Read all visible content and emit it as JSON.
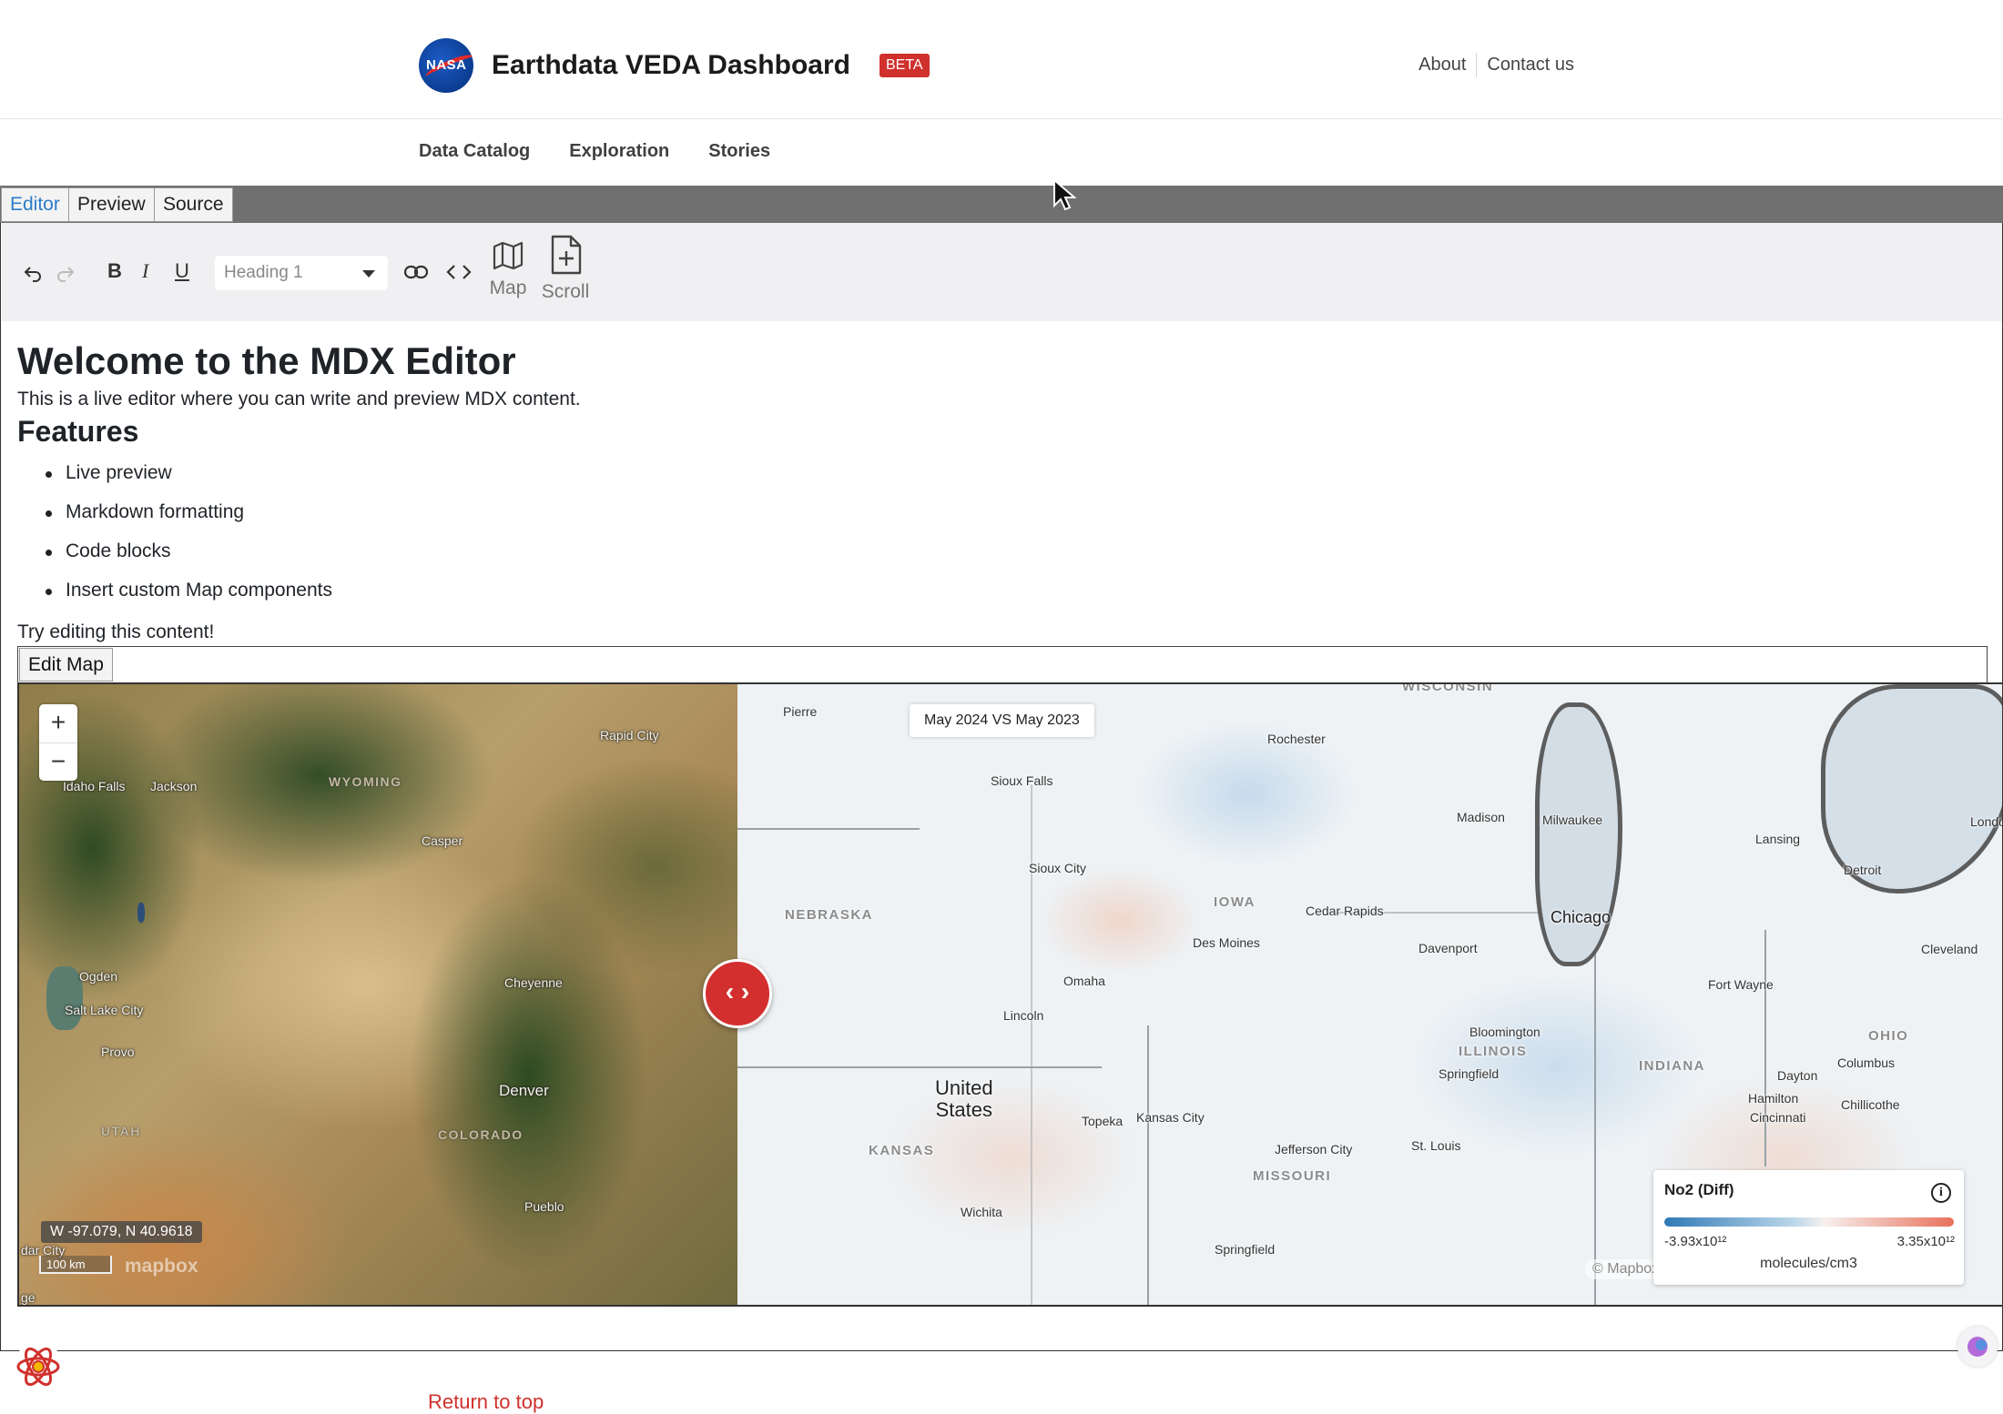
{
  "header": {
    "logo_icon": "nasa-logo",
    "logo_text": "NASA",
    "title": "Earthdata VEDA Dashboard",
    "badge": "BETA",
    "links": [
      "About",
      "Contact us"
    ]
  },
  "nav": [
    "Data Catalog",
    "Exploration",
    "Stories"
  ],
  "editor_tabs": {
    "editor": "Editor",
    "preview": "Preview",
    "source": "Source",
    "active": "Editor"
  },
  "toolbar": {
    "undo_icon": "undo-icon",
    "redo_icon": "redo-icon",
    "bold": "B",
    "italic": "I",
    "underline": "U",
    "block_type": "Heading 1",
    "link_icon": "link-icon",
    "code_icon": "code-icon",
    "map_label": "Map",
    "scroll_label": "Scroll"
  },
  "content": {
    "h1": "Welcome to the MDX Editor",
    "intro": "This is a live editor where you can write and preview MDX content.",
    "h2": "Features",
    "features": [
      "Live preview",
      "Markdown formatting",
      "Code blocks",
      "Insert custom Map components"
    ],
    "closing": "Try editing this content!"
  },
  "map": {
    "edit_button": "Edit Map",
    "zoom_in": "+",
    "zoom_out": "−",
    "coordinates": "W -97.079, N 40.9618",
    "scale": "100 km",
    "mapbox_logo": "mapbox",
    "compare_label": "May 2024 VS May 2023",
    "slider_handle": "‹ ›",
    "attribution": "© Mapbox ©",
    "left_places": {
      "rapid_city": "Rapid City",
      "idaho_falls": "Idaho Falls",
      "jackson": "Jackson",
      "wyoming": "WYOMING",
      "casper": "Casper",
      "ogden": "Ogden",
      "salt_lake_city": "Salt Lake City",
      "cheyenne": "Cheyenne",
      "provo": "Provo",
      "denver": "Denver",
      "utah": "UTAH",
      "colorado": "COLORADO",
      "pueblo": "Pueblo",
      "dar_city": "dar City",
      "ge": "ge"
    },
    "right_places": {
      "pierre": "Pierre",
      "wisconsin": "WISCONSIN",
      "rochester": "Rochester",
      "sioux_falls": "Sioux Falls",
      "madison": "Madison",
      "milwaukee": "Milwaukee",
      "london": "London",
      "lansing": "Lansing",
      "sioux_city": "Sioux City",
      "detroit": "Detroit",
      "nebraska": "NEBRASKA",
      "iowa": "IOWA",
      "cedar_rapids": "Cedar Rapids",
      "chicago": "Chicago",
      "des_moines": "Des Moines",
      "davenport": "Davenport",
      "cleveland": "Cleveland",
      "omaha": "Omaha",
      "fort_wayne": "Fort Wayne",
      "lincoln": "Lincoln",
      "bloomington": "Bloomington",
      "ohio": "OHIO",
      "illinois": "ILLINOIS",
      "indiana": "INDIANA",
      "columbus": "Columbus",
      "springfield_il": "Springfield",
      "dayton": "Dayton",
      "united_states": "United\nStates",
      "hamilton": "Hamilton",
      "chillicothe": "Chillicothe",
      "cincinnati": "Cincinnati",
      "topeka": "Topeka",
      "kansas_city": "Kansas City",
      "kansas": "KANSAS",
      "jefferson_city": "Jefferson City",
      "st_louis": "St. Louis",
      "missouri": "MISSOURI",
      "wichita": "Wichita",
      "springfield_mo": "Springfield"
    },
    "legend": {
      "title": "No2 (Diff)",
      "info_icon": "info-icon",
      "min": "-3.93x10¹²",
      "max": "3.35x10¹²",
      "unit": "molecules/cm3",
      "colors": [
        "#2f78b6",
        "#bcd8ea",
        "#f6f0ee",
        "#e8705a"
      ]
    }
  },
  "footer": {
    "return_to_top": "Return to top"
  },
  "colors": {
    "accent": "#d0312d",
    "tab_active": "#2c7dc9",
    "tab_bar": "#707070"
  }
}
